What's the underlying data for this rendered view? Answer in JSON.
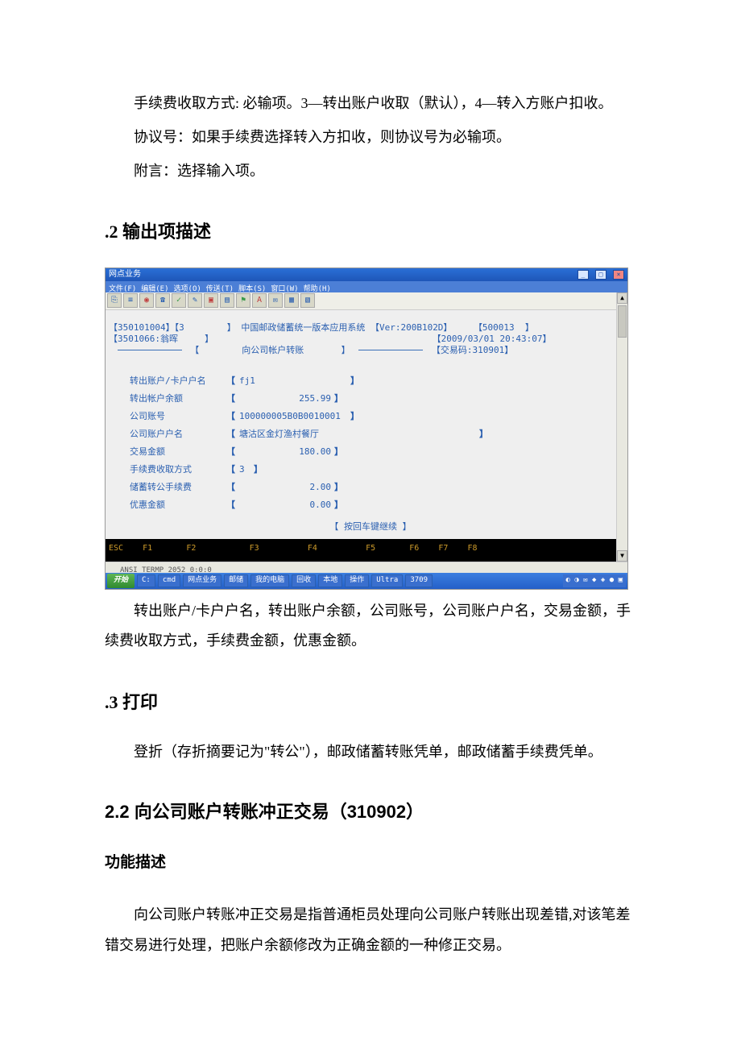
{
  "doc": {
    "p1": "手续费收取方式: 必输项。3—转出账户收取（默认），4—转入方账户扣收。",
    "p2": "协议号：如果手续费选择转入方扣收，则协议号为必输项。",
    "p3": "附言：选择输入项。",
    "h_out": ".2 输出项描述",
    "p_out": "转出账户/卡户户名，转出账户余额，公司账号，公司账户户名，交易金额，手续费收取方式，手续费金额，优惠金额。",
    "h_print": ".3 打印",
    "p_print": "登折（存折摘要记为\"转公\"），邮政储蓄转账凭单，邮政储蓄手续费凭单。",
    "h22": "2.2 向公司账户转账冲正交易（310902）",
    "h_func": "功能描述",
    "p_func": "向公司账户转账冲正交易是指普通柜员处理向公司账户转账出现差错,对该笔差错交易进行处理，把账户余额修改为正确金额的一种修正交易。"
  },
  "shot": {
    "window_title": "网点业务",
    "menus": [
      "文件(F)",
      "编辑(E)",
      "选项(O)",
      "传送(T)",
      "脚本(S)",
      "窗口(W)",
      "帮助(H)"
    ],
    "head_line1_left": "【350101004】【3",
    "head_line1_mid": "】 中国邮政储蓄统一版本应用系统 【Ver:200B102D】",
    "head_line1_right": "【500013  】",
    "head_line2_left": "【3501066:翁晖",
    "head_line2_mid": "】",
    "head_line2_right": "【2009/03/01 20:43:07】",
    "head_line3_title": "向公司帐户转账",
    "head_line3_code": "【交易码:310901】",
    "rows": [
      {
        "label": "转出账户/卡户户名",
        "lb": "【",
        "val": "fj1",
        "rb": "】",
        "align": "L"
      },
      {
        "label": "转出帐户余额",
        "lb": "【",
        "val": "255.99",
        "rb": "】",
        "align": "R"
      },
      {
        "label": "公司账号",
        "lb": "【",
        "val": "100000005B0B0010001",
        "rb": "】",
        "align": "L"
      },
      {
        "label": "公司账户户名",
        "lb": "【",
        "val": "塘沽区金灯渔村餐厅",
        "rb": "】",
        "align": "L",
        "wide": true
      },
      {
        "label": "交易金额",
        "lb": "【",
        "val": "180.00",
        "rb": "】",
        "align": "R"
      },
      {
        "label": "手续费收取方式",
        "lb": "【",
        "val": "3",
        "rb": "】",
        "align": "L"
      },
      {
        "label": "储蓄转公手续费",
        "lb": "【",
        "val": "2.00",
        "rb": "】",
        "align": "R"
      },
      {
        "label": "优惠金额",
        "lb": "【",
        "val": "0.00",
        "rb": "】",
        "align": "R"
      }
    ],
    "prompt": "【 按回车键继续 】",
    "fnbar": "ESC    F1       F2           F3          F4          F5       F6    F7    F8",
    "status": "ANSI TERMP 2052  0:0:0",
    "taskbar": {
      "start": "开始",
      "items": [
        "C:",
        "cmd",
        "网点业务",
        "邮储",
        "我的电脑",
        "回收",
        "本地",
        "操作",
        "Ultra",
        "3709"
      ]
    }
  }
}
